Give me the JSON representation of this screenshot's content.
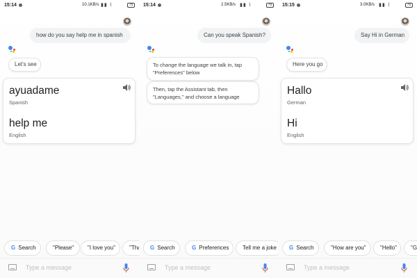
{
  "colors": {
    "assistant_blue": "#4285f4",
    "assistant_red": "#ea4335",
    "assistant_yellow": "#fbbc05",
    "assistant_green": "#34a853",
    "bubble_gray": "#f1f3f4"
  },
  "icons": {
    "assistant": "google-assistant-dots-icon",
    "speaker": "speaker-icon",
    "google": "google-g-icon",
    "keyboard": "keyboard-icon",
    "mic": "microphone-icon",
    "avatar": "user-avatar"
  },
  "panels": [
    {
      "status": {
        "time": "15:14",
        "speed": "10.1KB/s",
        "battery": "75"
      },
      "user_query": "how do you say help me in spanish",
      "reply": "Let's see",
      "card": {
        "word1": "ayuadame",
        "lang1": "Spanish",
        "word2": "help me",
        "lang2": "English"
      },
      "chips": [
        {
          "label": "Search",
          "g": "G"
        },
        {
          "label": "\"Please\""
        },
        {
          "label": "\"I love you\""
        },
        {
          "label": "\"Tha"
        }
      ],
      "input_placeholder": "Type a message"
    },
    {
      "status": {
        "time": "15:14",
        "speed": "2.5KB/s",
        "battery": "75"
      },
      "user_query": "Can you speak Spanish?",
      "texts": [
        "To change the language we talk in, tap \"Preferences\" below",
        "Then, tap the Assistant tab, then \"Languages,\" and choose a language"
      ],
      "chips": [
        {
          "label": "Search",
          "g": "G"
        },
        {
          "label": "Preferences",
          "g": "G"
        },
        {
          "label": "Tell me a joke"
        }
      ],
      "input_placeholder": "Type a message"
    },
    {
      "status": {
        "time": "15:15",
        "speed": "3.0KB/s",
        "battery": "75"
      },
      "user_query": "Say Hi in German",
      "reply": "Here you go",
      "card": {
        "word1": "Hallo",
        "lang1": "German",
        "word2": "Hi",
        "lang2": "English"
      },
      "chips": [
        {
          "label": "Search",
          "g": "G"
        },
        {
          "label": "\"How are you\""
        },
        {
          "label": "\"Hello\""
        },
        {
          "label": "\"Go"
        }
      ],
      "input_placeholder": "Type a message"
    }
  ]
}
